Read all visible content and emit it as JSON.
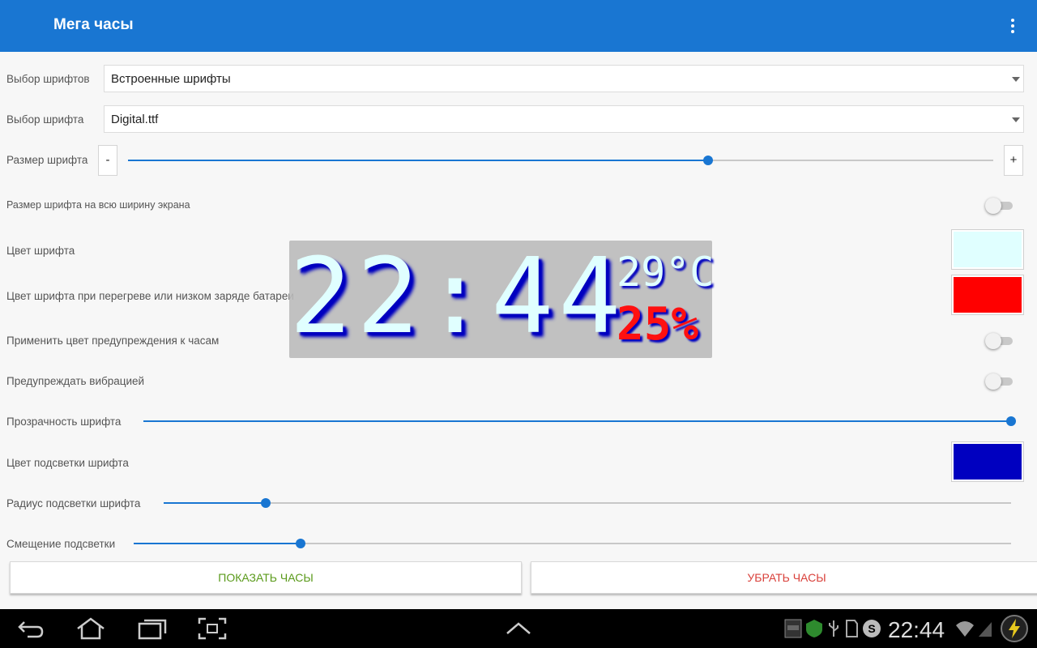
{
  "appbar": {
    "title": "Мега часы"
  },
  "settings": {
    "font_source": {
      "label": "Выбор шрифтов",
      "value": "Встроенные шрифты"
    },
    "font": {
      "label": "Выбор шрифта",
      "value": "Digital.ttf"
    },
    "font_size": {
      "label": "Размер шрифта",
      "minus": "-",
      "plus": "+",
      "level": 0.67
    },
    "full_width": {
      "label": "Размер шрифта на всю ширину экрана",
      "on": false
    },
    "font_color": {
      "label": "Цвет шрифта",
      "color": "#e0ffff"
    },
    "warn_color": {
      "label": "Цвет шрифта при перегреве или низком заряде батареи",
      "color": "#ff0000"
    },
    "apply_warn": {
      "label": "Применить цвет предупреждения к часам",
      "on": false
    },
    "vibrate": {
      "label": "Предупреждать вибрацией",
      "on": false
    },
    "opacity": {
      "label": "Прозрачность шрифта",
      "level": 1.0
    },
    "glow_color": {
      "label": "Цвет подсветки шрифта",
      "color": "#0000c0"
    },
    "glow_radius": {
      "label": "Радиус подсветки шрифта",
      "level": 0.12
    },
    "glow_offset": {
      "label": "Смещение подсветки",
      "level": 0.19
    }
  },
  "clock_preview": {
    "time": "22:44",
    "temperature": "29°C",
    "battery": "25%"
  },
  "buttons": {
    "show": "ПОКАЗАТЬ ЧАСЫ",
    "hide": "УБРАТЬ ЧАСЫ",
    "show_color": "#5a9a1a",
    "hide_color": "#d9403a"
  },
  "system_bar": {
    "time": "22:44"
  },
  "colors": {
    "accent": "#1976d2"
  }
}
